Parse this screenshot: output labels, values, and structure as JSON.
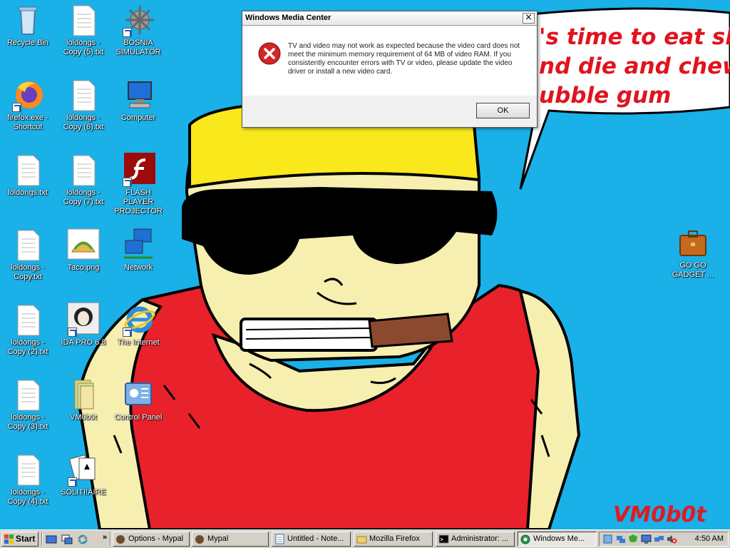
{
  "desktop": {
    "icons": [
      {
        "label": "Recycle Bin"
      },
      {
        "label": "loldongs - Copy (5).txt"
      },
      {
        "label": "BOSNIA SIMULATOR"
      },
      {
        "label": "firefox.exe - Shortcut"
      },
      {
        "label": "loldongs - Copy (6).txt"
      },
      {
        "label": "Computer"
      },
      {
        "label": "loldongs.txt"
      },
      {
        "label": "loldongs - Copy (7).txt"
      },
      {
        "label": "FLASH PLAYER PROJECTOR"
      },
      {
        "label": "loldongs - Copy.txt"
      },
      {
        "label": "Taco.png"
      },
      {
        "label": "Network"
      },
      {
        "label": "loldongs - Copy (2).txt"
      },
      {
        "label": "IDA PRO 6.8"
      },
      {
        "label": "The Internet"
      },
      {
        "label": "loldongs - Copy (3).txt"
      },
      {
        "label": "VM0b0t"
      },
      {
        "label": "Control Panel"
      },
      {
        "label": "loldongs - Copy (4).txt"
      },
      {
        "label": "SOLITI!AIRE"
      },
      {
        "label": "GO GO GADGET ..."
      }
    ]
  },
  "wallpaper": {
    "bubble_lines": [
      "'s time to eat shit",
      "nd die and chew",
      "ubble gum"
    ],
    "signature": "VM0b0t"
  },
  "dialog": {
    "title": "Windows Media Center",
    "close_label": "×",
    "message": "TV and video may not work as expected because the video card does not meet the minimum memory requirement of 64 MB of video RAM. If you consistently encounter errors with TV or video, please update the video driver or install a new video card.",
    "ok_label": "OK"
  },
  "taskbar": {
    "start_label": "Start",
    "overflow_label": "»",
    "buttons": [
      {
        "label": "Options - Mypal"
      },
      {
        "label": "Mypal"
      },
      {
        "label": "Untitled - Note..."
      },
      {
        "label": "Mozilla Firefox"
      },
      {
        "label": "Administrator: ..."
      },
      {
        "label": "Windows Me..."
      }
    ],
    "clock": "4:50 AM"
  },
  "colors": {
    "desktop_bg": "#1ab0e8",
    "bubble_text": "#e0141e",
    "shirt": "#e8212a",
    "skin": "#f7efb0",
    "hat": "#f8e81c"
  }
}
